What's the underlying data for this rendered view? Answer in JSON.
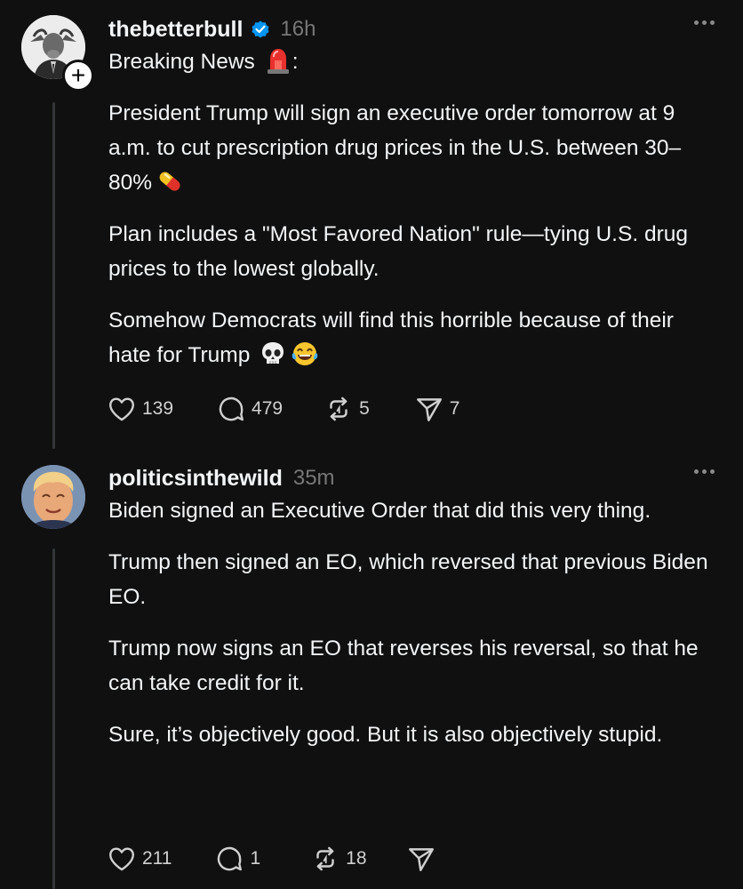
{
  "posts": [
    {
      "username": "thebetterbull",
      "verified": true,
      "time": "16h",
      "paragraphs": [
        "Breaking News",
        "President Trump will sign an executive order tomorrow at 9 a.m. to cut prescription drug prices in the U.S. between 30–80%",
        "Plan includes a \"Most Favored Nation\" rule—tying U.S. drug prices to the lowest globally.",
        "Somehow Democrats will find this horrible because of their hate for Trump"
      ],
      "p1_suffix": ":",
      "emojis": [
        "rotating-light",
        "pill",
        "skull",
        "face-with-tears-of-joy"
      ],
      "likes": "139",
      "replies": "479",
      "reposts": "5",
      "shares": "7"
    },
    {
      "username": "politicsinthewild",
      "verified": false,
      "time": "35m",
      "paragraphs": [
        "Biden signed an Executive Order that did this very thing.",
        "Trump then signed an EO, which reversed that previous Biden EO.",
        "Trump now signs an EO that reverses his reversal, so that he can take credit for it.",
        "Sure, it’s objectively good. But it is also objectively stupid."
      ],
      "likes": "211",
      "replies": "1",
      "reposts": "18",
      "shares": ""
    }
  ],
  "colors": {
    "background": "#101010",
    "text": "#f3f5f7",
    "muted": "#777777",
    "verified": "#0095f6",
    "thread_line": "#333638"
  }
}
